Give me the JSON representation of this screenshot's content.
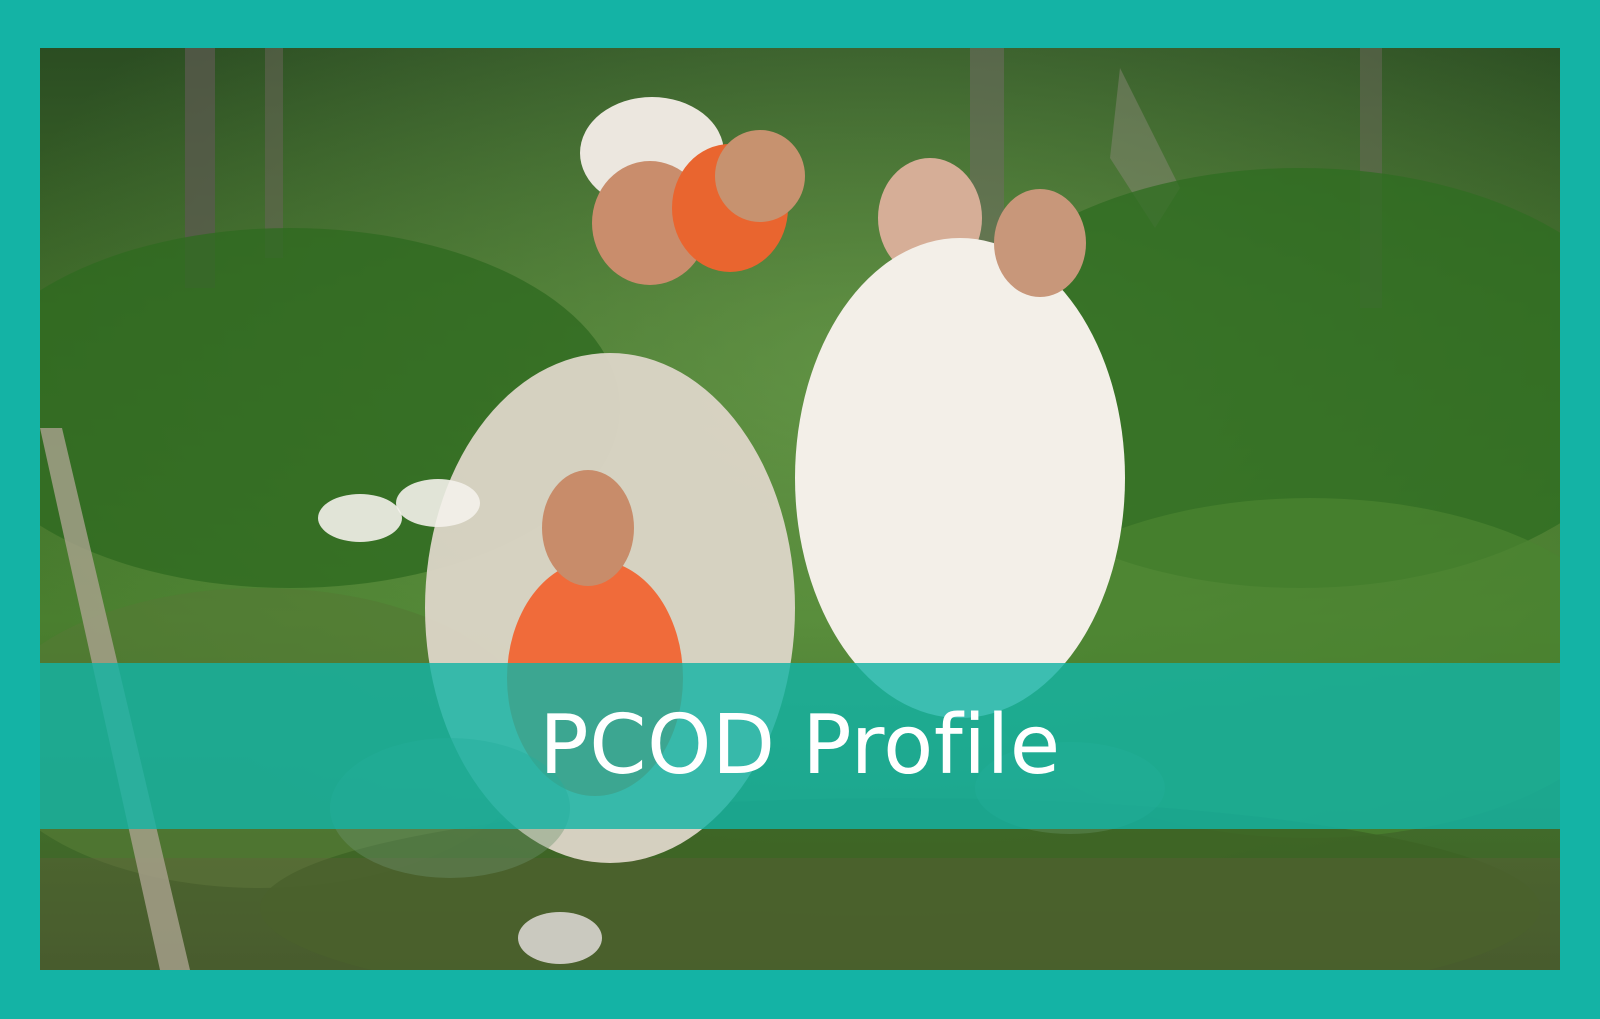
{
  "banner": {
    "title": "PCOD Profile"
  },
  "colors": {
    "frame": "#14b3a5",
    "banner_overlay": "#14b3a5",
    "text": "#ffffff"
  }
}
